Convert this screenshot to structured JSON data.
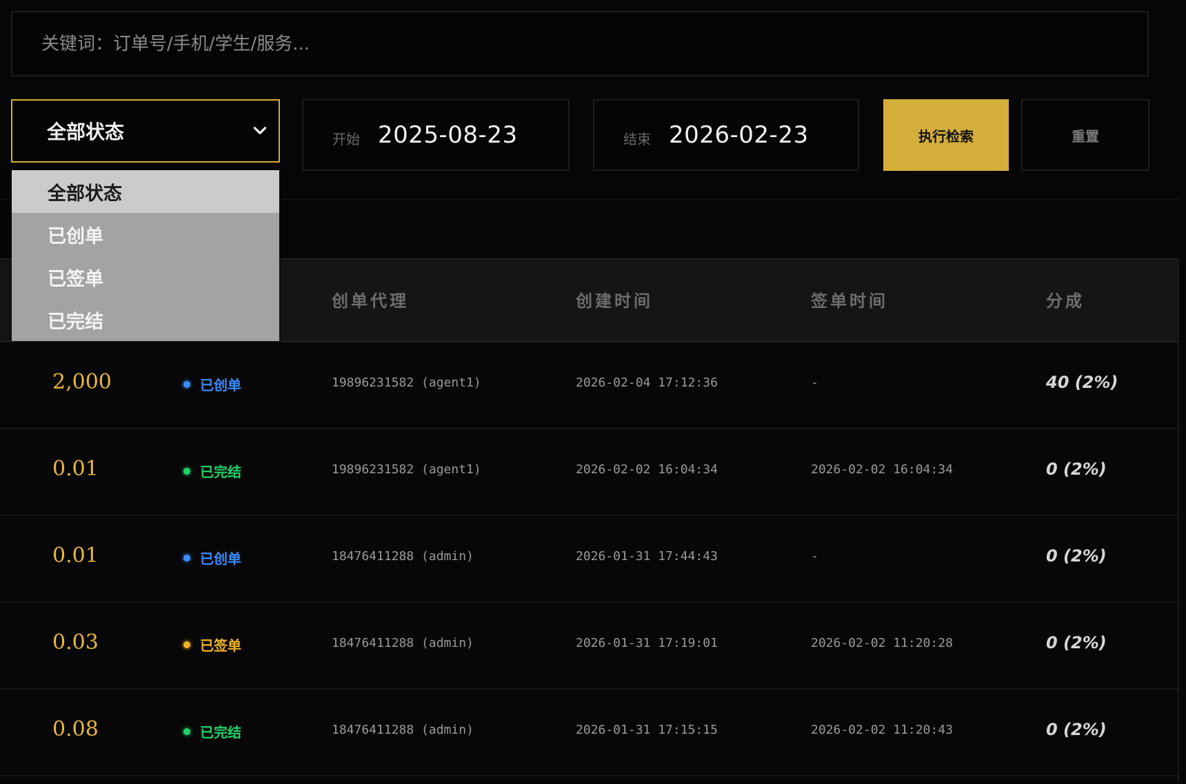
{
  "search": {
    "placeholder": "关键词：订单号/手机/学生/服务..."
  },
  "filters": {
    "status_selected": "全部状态",
    "start_label": "开始",
    "start_value": "2025-08-23",
    "end_label": "结束",
    "end_value": "2026-02-23",
    "search_button": "执行检索",
    "reset_button": "重置"
  },
  "dropdown": {
    "options": [
      "全部状态",
      "已创单",
      "已签单",
      "已完结"
    ]
  },
  "table": {
    "headers": [
      "创单代理",
      "创建时间",
      "签单时间",
      "分成"
    ],
    "rows": [
      {
        "amount": "2,000",
        "status": "已创单",
        "status_color": "#3d8bff",
        "agent": "19896231582 (agent1)",
        "created": "2026-02-04 17:12:36",
        "signed": "-",
        "split": "40 (2%)"
      },
      {
        "amount": "0.01",
        "status": "已完结",
        "status_color": "#22d06a",
        "agent": "19896231582 (agent1)",
        "created": "2026-02-02 16:04:34",
        "signed": "2026-02-02 16:04:34",
        "split": "0 (2%)"
      },
      {
        "amount": "0.01",
        "status": "已创单",
        "status_color": "#3d8bff",
        "agent": "18476411288 (admin)",
        "created": "2026-01-31 17:44:43",
        "signed": "-",
        "split": "0 (2%)"
      },
      {
        "amount": "0.03",
        "status": "已签单",
        "status_color": "#f0b429",
        "agent": "18476411288 (admin)",
        "created": "2026-01-31 17:19:01",
        "signed": "2026-02-02 11:20:28",
        "split": "0 (2%)"
      },
      {
        "amount": "0.08",
        "status": "已完结",
        "status_color": "#22d06a",
        "agent": "18476411288 (admin)",
        "created": "2026-01-31 17:15:15",
        "signed": "2026-02-02 11:20:43",
        "split": "0 (2%)"
      }
    ]
  },
  "colors": {
    "accent": "#d4ae3a",
    "amount": "#e8b640"
  },
  "icons": {
    "select_chevron": "chevron-down-icon"
  }
}
